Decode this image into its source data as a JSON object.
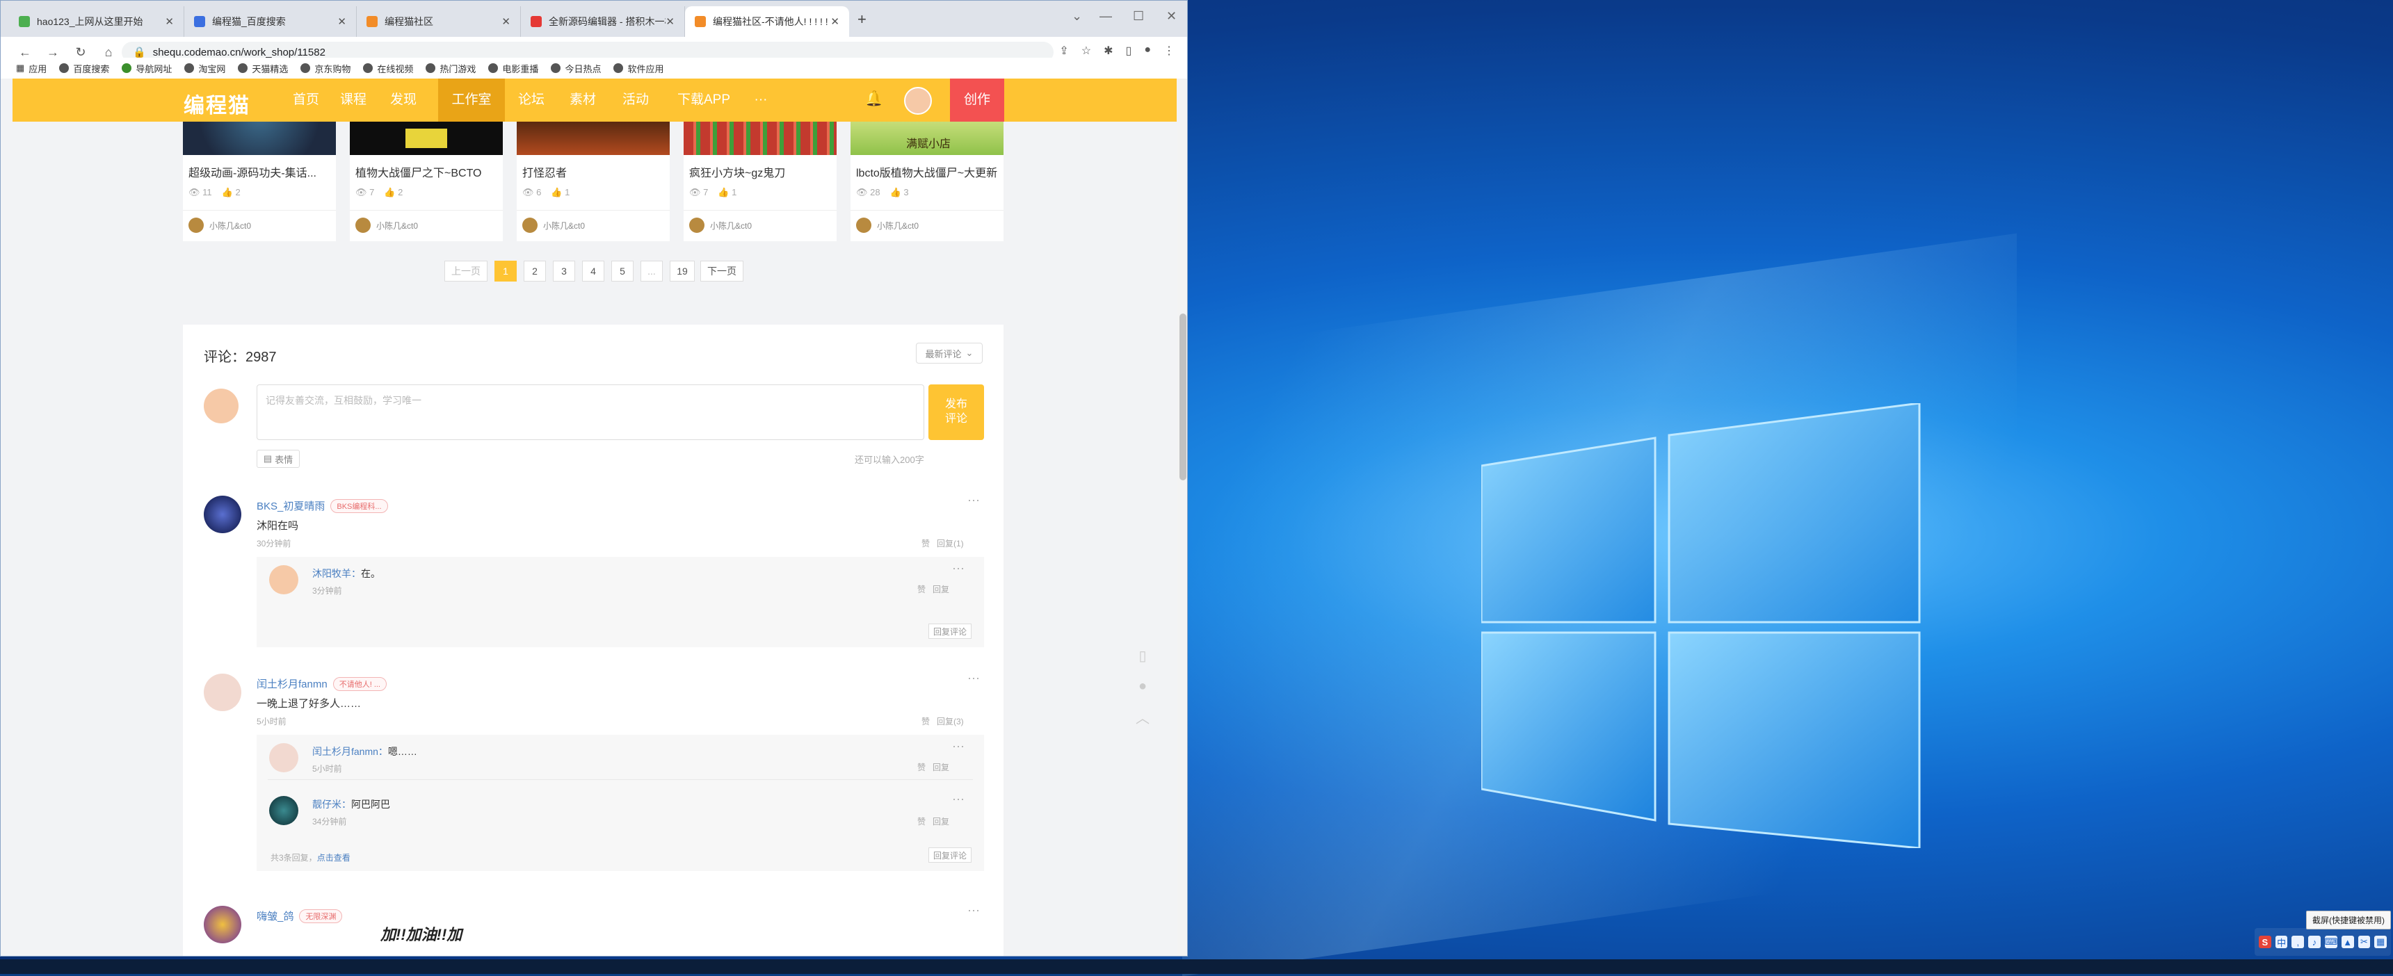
{
  "browser": {
    "tabs": [
      {
        "label": "hao123_上网从这里开始",
        "color": "#4caf50"
      },
      {
        "label": "编程猫_百度搜索",
        "color": "#3b6fe0"
      },
      {
        "label": "编程猫社区",
        "color": "#f28c28"
      },
      {
        "label": "全新源码编辑器 - 搭积木一样来...",
        "color": "#e53935"
      },
      {
        "label": "编程猫社区-不请他人! ! ! ! !",
        "color": "#f28c28"
      }
    ],
    "url": "shequ.codemao.cn/work_shop/11582",
    "bookmarks": [
      "应用",
      "百度搜索",
      "导航网址",
      "淘宝网",
      "天猫精选",
      "京东购物",
      "在线视频",
      "热门游戏",
      "电影重播",
      "今日热点",
      "软件应用"
    ]
  },
  "site": {
    "logo": "编程猫",
    "nav": [
      "首页",
      "课程",
      "发现",
      "工作室",
      "论坛",
      "素材",
      "活动",
      "下载APP",
      "···"
    ],
    "create_label": "创作"
  },
  "works": [
    {
      "title": "超级动画-源码功夫-集话...",
      "views": "11",
      "likes": "2",
      "author": "小陈几&ct0",
      "color": "#25364f"
    },
    {
      "title": "植物大战僵尸之下~BCTO",
      "views": "7",
      "likes": "2",
      "author": "小陈几&ct0",
      "color": "#101010"
    },
    {
      "title": "打怪忍者",
      "views": "6",
      "likes": "1",
      "author": "小陈几&ct0",
      "color": "#8b3a1e"
    },
    {
      "title": "疯狂小方块~gz鬼刀",
      "views": "7",
      "likes": "1",
      "author": "小陈几&ct0",
      "color": "#c33a2e"
    },
    {
      "title": "lbcto版植物大战僵尸~大更新",
      "views": "28",
      "likes": "3",
      "author": "小陈几&ct0",
      "color": "#8fc24a",
      "overlay": "满赋小店"
    }
  ],
  "pagination": {
    "prev": "上一页",
    "pages": [
      "1",
      "2",
      "3",
      "4",
      "5",
      "...",
      "19"
    ],
    "next": "下一页"
  },
  "comments": {
    "count_label": "评论：2987",
    "sort_label": "最新评论",
    "input_placeholder": "记得友善交流，互相鼓励，学习唯一",
    "publish_label": "发布\n评论",
    "emoji_label": "表情",
    "char_hint": "还可以输入200字",
    "items": [
      {
        "name": "BKS_初夏晴雨",
        "badge": "BKS编程科...",
        "text": "沐阳在吗",
        "time": "30分钟前",
        "like": "赞",
        "reply": "回复(1)",
        "replies": [
          {
            "name": "沐阳牧羊：",
            "text": "在。",
            "time": "3分钟前",
            "like": "赞",
            "reply": "回复"
          }
        ],
        "reply_comment": "回复评论"
      },
      {
        "name": "闰土杉月fanmn",
        "badge": "不请他人! ...",
        "text": "一晚上退了好多人……",
        "time": "5小时前",
        "like": "赞",
        "reply": "回复(3)",
        "replies": [
          {
            "name": "闰土杉月fanmn：",
            "text": "嗯……",
            "time": "5小时前",
            "like": "赞",
            "reply": "回复"
          },
          {
            "name": "靓仔米：",
            "text": "阿巴阿巴",
            "time": "34分钟前",
            "like": "赞",
            "reply": "回复"
          }
        ],
        "expand_prefix": "共3条回复，",
        "expand_link": "点击查看",
        "reply_comment": "回复评论"
      },
      {
        "name": "嗨皱_鸽",
        "badge": "无限深渊",
        "image_text": "加!!加油!!加"
      }
    ]
  },
  "desktop": {
    "tooltip": "截屏(快捷键被禁用)",
    "ime_label": "S",
    "tray_cn": "中"
  },
  "colors": {
    "brand": "#fec433",
    "create": "#f35151",
    "link": "#4a7fc1"
  }
}
